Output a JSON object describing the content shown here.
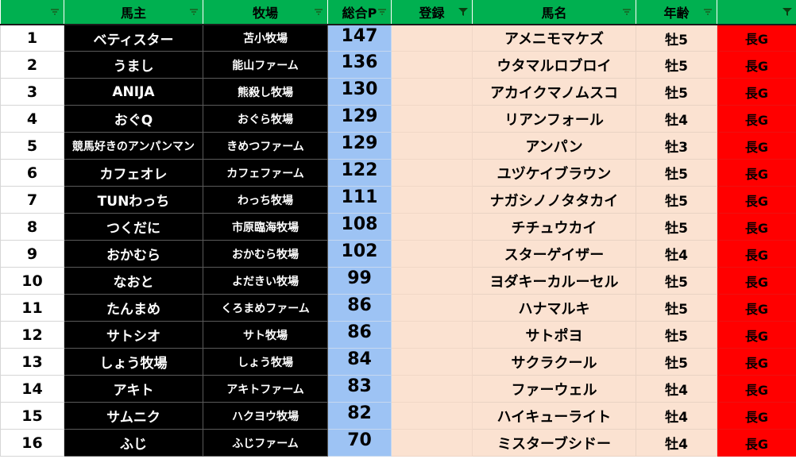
{
  "sheet": {
    "headers": {
      "rank": "",
      "owner": "馬主",
      "farm": "牧場",
      "points": "総合P",
      "registration": "登録",
      "horse": "馬名",
      "age": "年齢",
      "distance": ""
    },
    "filter_states": {
      "rank": "dropdown",
      "owner": "dropdown",
      "farm": "dropdown",
      "points": "dropdown",
      "registration": "filtered",
      "horse": "dropdown",
      "age": "dropdown",
      "distance": "filtered"
    },
    "colors": {
      "header_bg": "#00b050",
      "owner_bg": "#000000",
      "points_bg": "#9dc3f4",
      "horse_bg": "#fbe2d1",
      "distance_bg": "#ff0000"
    },
    "rows": [
      {
        "rank": "1",
        "owner": "ベティスター",
        "farm": "苫小牧場",
        "points": "147",
        "registration": "",
        "horse": "アメニモマケズ",
        "age": "牡5",
        "distance": "長G"
      },
      {
        "rank": "2",
        "owner": "うまし",
        "farm": "能山ファーム",
        "points": "136",
        "registration": "",
        "horse": "ウタマルロブロイ",
        "age": "牡5",
        "distance": "長G"
      },
      {
        "rank": "3",
        "owner": "ANIJA",
        "farm": "熊殺し牧場",
        "points": "130",
        "registration": "",
        "horse": "アカイクマノムスコ",
        "age": "牡5",
        "distance": "長G"
      },
      {
        "rank": "4",
        "owner": "おぐQ",
        "farm": "おぐら牧場",
        "points": "129",
        "registration": "",
        "horse": "リアンフォール",
        "age": "牡4",
        "distance": "長G"
      },
      {
        "rank": "5",
        "owner": "競馬好きのアンパンマン",
        "farm": "きめつファーム",
        "points": "129",
        "registration": "",
        "horse": "アンパン",
        "age": "牡3",
        "distance": "長G"
      },
      {
        "rank": "6",
        "owner": "カフェオレ",
        "farm": "カフェファーム",
        "points": "122",
        "registration": "",
        "horse": "ユヅケイブラウン",
        "age": "牡5",
        "distance": "長G"
      },
      {
        "rank": "7",
        "owner": "TUNわっち",
        "farm": "わっち牧場",
        "points": "111",
        "registration": "",
        "horse": "ナガシノノタタカイ",
        "age": "牡5",
        "distance": "長G"
      },
      {
        "rank": "8",
        "owner": "つくだに",
        "farm": "市原臨海牧場",
        "points": "108",
        "registration": "",
        "horse": "チチュウカイ",
        "age": "牡5",
        "distance": "長G"
      },
      {
        "rank": "9",
        "owner": "おかむら",
        "farm": "おかむら牧場",
        "points": "102",
        "registration": "",
        "horse": "スターゲイザー",
        "age": "牡4",
        "distance": "長G"
      },
      {
        "rank": "10",
        "owner": "なおと",
        "farm": "よだきい牧場",
        "points": "99",
        "registration": "",
        "horse": "ヨダキーカルーセル",
        "age": "牡5",
        "distance": "長G"
      },
      {
        "rank": "11",
        "owner": "たんまめ",
        "farm": "くろまめファーム",
        "points": "86",
        "registration": "",
        "horse": "ハナマルキ",
        "age": "牡5",
        "distance": "長G"
      },
      {
        "rank": "12",
        "owner": "サトシオ",
        "farm": "サト牧場",
        "points": "86",
        "registration": "",
        "horse": "サトポヨ",
        "age": "牡5",
        "distance": "長G"
      },
      {
        "rank": "13",
        "owner": "しょう牧場",
        "farm": "しょう牧場",
        "points": "84",
        "registration": "",
        "horse": "サクラクール",
        "age": "牡5",
        "distance": "長G"
      },
      {
        "rank": "14",
        "owner": "アキト",
        "farm": "アキトファーム",
        "points": "83",
        "registration": "",
        "horse": "ファーウェル",
        "age": "牡4",
        "distance": "長G"
      },
      {
        "rank": "15",
        "owner": "サムニク",
        "farm": "ハクヨウ牧場",
        "points": "82",
        "registration": "",
        "horse": "ハイキューライト",
        "age": "牡4",
        "distance": "長G"
      },
      {
        "rank": "16",
        "owner": "ふじ",
        "farm": "ふじファーム",
        "points": "70",
        "registration": "",
        "horse": "ミスターブシドー",
        "age": "牡4",
        "distance": "長G"
      }
    ]
  }
}
